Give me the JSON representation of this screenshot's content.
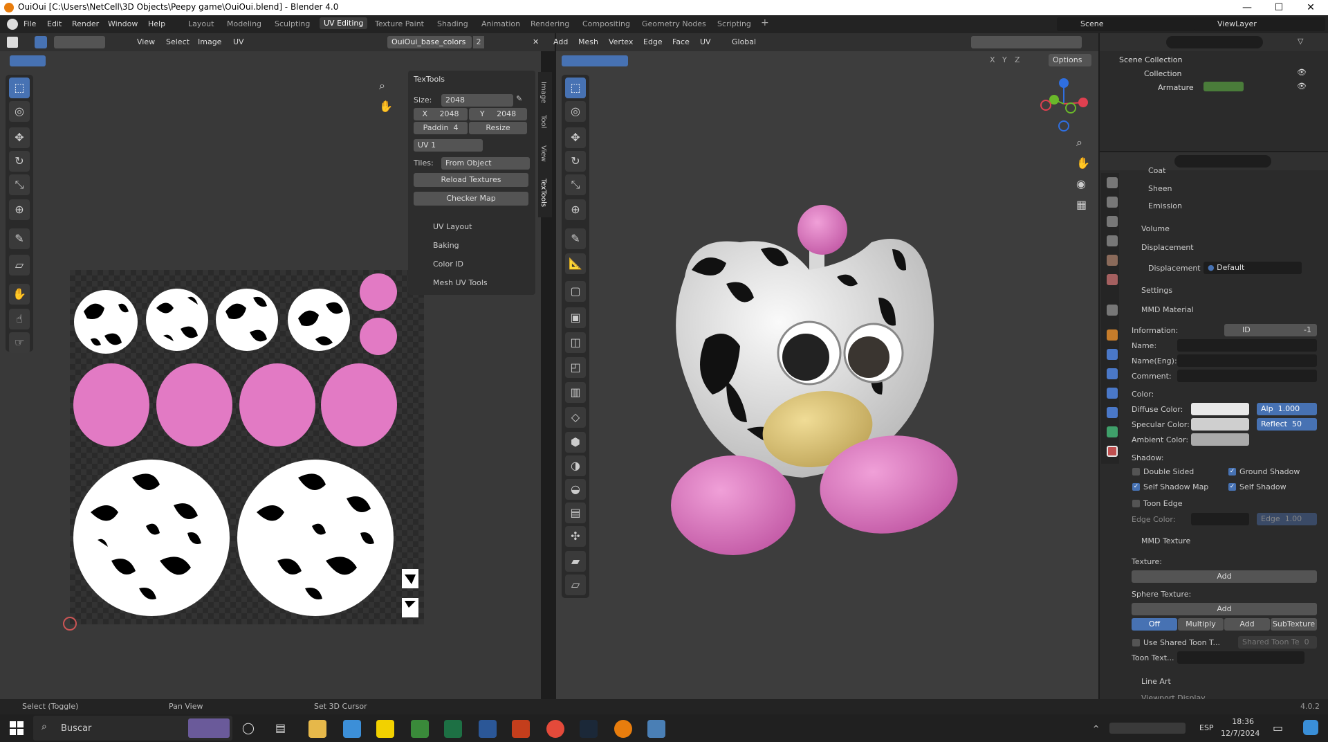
{
  "window": {
    "title": "OuiOui [C:\\Users\\NetCell\\3D Objects\\Peepy game\\OuiOui.blend] - Blender 4.0",
    "minimize": "—",
    "maximize": "☐",
    "close": "✕"
  },
  "menus": [
    "File",
    "Edit",
    "Render",
    "Window",
    "Help"
  ],
  "workspaces": [
    "Layout",
    "Modeling",
    "Sculpting",
    "UV Editing",
    "Texture Paint",
    "Shading",
    "Animation",
    "Rendering",
    "Compositing",
    "Geometry Nodes",
    "Scripting",
    "+"
  ],
  "scene": {
    "name": "Scene",
    "view_layer": "ViewLayer"
  },
  "uv_header": {
    "menus": [
      "View",
      "Select",
      "Image",
      "UV"
    ],
    "image_name": "OuiOui_base_colors",
    "users": "2"
  },
  "viewport_header": {
    "menus": [
      "Add",
      "Mesh",
      "Vertex",
      "Edge",
      "Face",
      "UV"
    ],
    "orientation": "Global",
    "options": "Options",
    "axes": [
      "X",
      "Y",
      "Z"
    ]
  },
  "textools": {
    "title": "TexTools",
    "size_label": "Size:",
    "size_value": "2048",
    "x_label": "X",
    "x_value": "2048",
    "y_label": "Y",
    "y_value": "2048",
    "padding_label": "Paddin",
    "padding_value": "4",
    "resize": "Resize",
    "uv_map": "UV 1",
    "tiles_label": "Tiles:",
    "tiles_value": "From Object",
    "reload": "Reload Textures",
    "checker": "Checker Map",
    "sections": [
      "UV Layout",
      "Baking",
      "Color ID",
      "Mesh UV Tools"
    ]
  },
  "side_tabs": [
    "Image",
    "Tool",
    "View",
    "TexTools"
  ],
  "outliner": {
    "root": "Scene Collection",
    "collection": "Collection",
    "armature": "Armature"
  },
  "properties": {
    "top_items": [
      "Coat",
      "Sheen",
      "Emission"
    ],
    "volume": "Volume",
    "displacement": {
      "header": "Displacement",
      "label": "Displacement",
      "value": "Default"
    },
    "settings": "Settings",
    "mmd_material": {
      "header": "MMD Material",
      "information": "Information:",
      "info_value": "ID",
      "info_num": "-1",
      "name": "Name:",
      "name_eng": "Name(Eng):",
      "comment": "Comment:",
      "color": "Color:",
      "diffuse": "Diffuse Color:",
      "alpha": "Alp",
      "alpha_value": "1.000",
      "specular": "Specular Color:",
      "reflect": "Reflect",
      "reflect_value": "50",
      "ambient": "Ambient Color:",
      "shadow": "Shadow:",
      "double_sided": "Double Sided",
      "ground_shadow": "Ground Shadow",
      "self_shadow_map": "Self Shadow Map",
      "self_shadow": "Self Shadow",
      "toon_edge": "Toon Edge",
      "edge_color": "Edge Color:",
      "edge": "Edge",
      "edge_value": "1.00"
    },
    "mmd_texture": {
      "header": "MMD Texture",
      "texture": "Texture:",
      "add": "Add",
      "sphere_texture": "Sphere Texture:",
      "sphere_modes": [
        "Off",
        "Multiply",
        "Add",
        "SubTexture"
      ],
      "use_shared_toon": "Use Shared Toon T...",
      "shared_toon": "Shared Toon Te",
      "shared_toon_value": "0",
      "toon_texture": "Toon Text..."
    },
    "line_art": "Line Art",
    "viewport_display": "Viewport Display"
  },
  "status_bar": {
    "select": "Select (Toggle)",
    "pan": "Pan View",
    "cursor": "Set 3D Cursor",
    "version": "4.0.2"
  },
  "taskbar": {
    "search": "Buscar",
    "lang": "ESP",
    "time": "18:36",
    "date": "12/7/2024"
  },
  "colors": {
    "accent": "#4772b3",
    "pink": "#e27ac4",
    "beak": "#e0c779",
    "bg": "#393939"
  }
}
